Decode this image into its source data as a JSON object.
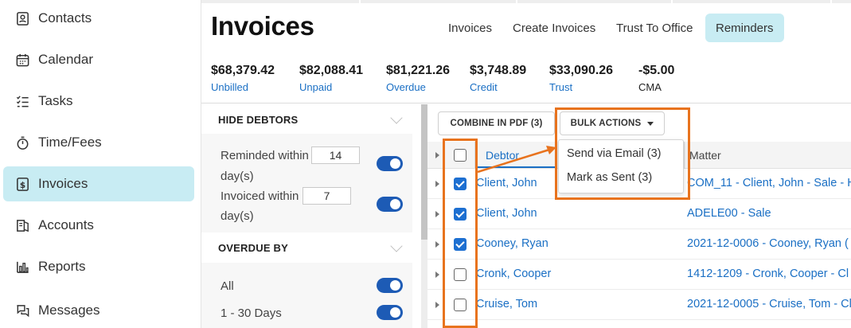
{
  "sidebar": {
    "items": [
      {
        "label": "Contacts",
        "icon": "contacts-icon"
      },
      {
        "label": "Calendar",
        "icon": "calendar-icon"
      },
      {
        "label": "Tasks",
        "icon": "tasks-icon"
      },
      {
        "label": "Time/Fees",
        "icon": "stopwatch-icon"
      },
      {
        "label": "Invoices",
        "icon": "invoice-dollar-icon",
        "active": true
      },
      {
        "label": "Accounts",
        "icon": "ledger-icon"
      },
      {
        "label": "Reports",
        "icon": "bar-chart-icon"
      },
      {
        "label": "Messages",
        "icon": "messages-icon"
      }
    ],
    "active_color": "#c8ecf3"
  },
  "header": {
    "title": "Invoices",
    "tabs": [
      {
        "label": "Invoices"
      },
      {
        "label": "Create Invoices"
      },
      {
        "label": "Trust To Office"
      },
      {
        "label": "Reminders",
        "active": true
      }
    ]
  },
  "summary": [
    {
      "amount": "$68,379.42",
      "label": "Unbilled"
    },
    {
      "amount": "$82,088.41",
      "label": "Unpaid"
    },
    {
      "amount": "$81,221.26",
      "label": "Overdue"
    },
    {
      "amount": "$3,748.89",
      "label": "Credit"
    },
    {
      "amount": "$33,090.26",
      "label": "Trust"
    },
    {
      "amount": "-$5.00",
      "label": "CMA"
    }
  ],
  "filters": {
    "hide_debtors": {
      "title": "HIDE DEBTORS",
      "reminded_label": "Reminded within",
      "reminded_value": "14",
      "reminded_unit": "day(s)",
      "invoiced_label": "Invoiced within",
      "invoiced_value": "7",
      "invoiced_unit": "day(s)"
    },
    "overdue_by": {
      "title": "OVERDUE BY",
      "options": [
        {
          "label": "All",
          "enabled": true
        },
        {
          "label": "1 - 30 Days",
          "enabled": true
        }
      ]
    }
  },
  "toolbar": {
    "combine_label": "COMBINE IN PDF (3)",
    "bulk_label": "BULK ACTIONS"
  },
  "bulk_menu": {
    "items": [
      "Send via Email (3)",
      "Mark as Sent (3)"
    ]
  },
  "table": {
    "columns": [
      "Debtor",
      "Matter"
    ],
    "rows": [
      {
        "checked": true,
        "debtor": "Client, John",
        "matter": "COM_11 - Client, John - Sale - H"
      },
      {
        "checked": true,
        "debtor": "Client, John",
        "matter": "ADELE00 - Sale"
      },
      {
        "checked": true,
        "debtor": "Cooney, Ryan",
        "matter": "2021-12-0006 - Cooney, Ryan ("
      },
      {
        "checked": false,
        "debtor": "Cronk, Cooper",
        "matter": "1412-1209 - Cronk, Cooper - Cl"
      },
      {
        "checked": false,
        "debtor": "Cruise, Tom",
        "matter": "2021-12-0005 - Cruise, Tom - Cl"
      }
    ]
  },
  "colors": {
    "accent": "#1d5bb5",
    "link": "#1a6fc4",
    "highlight": "#e8731e"
  }
}
